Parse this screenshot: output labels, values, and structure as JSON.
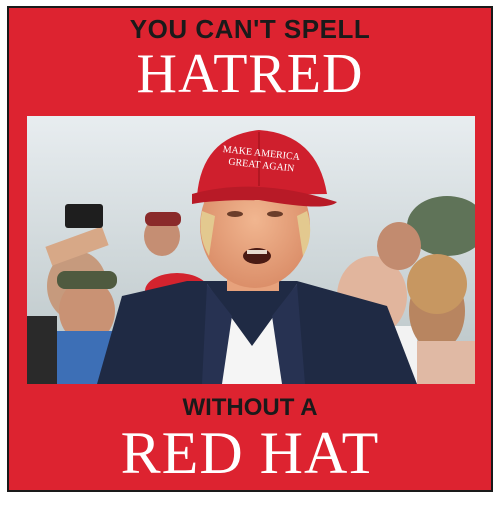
{
  "meme": {
    "top_caption": "YOU CAN'T SPELL",
    "top_big": "HATRED",
    "middle_caption": "WITHOUT A",
    "bottom_big": "RED HAT",
    "hat_text_line1": "MAKE AMERICA",
    "hat_text_line2": "GREAT AGAIN"
  },
  "colors": {
    "frame_red": "#dd2330",
    "text_dark": "#1a1a1a",
    "text_white": "#ffffff",
    "hat_red": "#cf1f2d"
  }
}
